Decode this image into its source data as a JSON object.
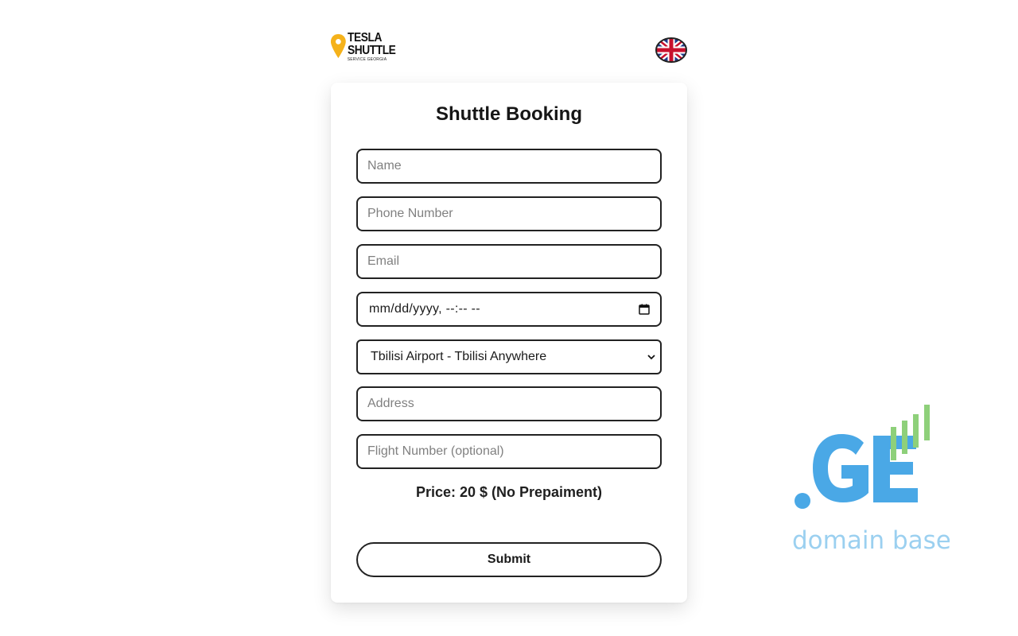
{
  "header": {
    "logo_line1": "TESLA",
    "logo_line2": "SHUTTLE",
    "logo_tagline": "SERVICE GEORGIA",
    "language_flag": "uk-flag-icon"
  },
  "form": {
    "title": "Shuttle Booking",
    "name_placeholder": "Name",
    "phone_placeholder": "Phone Number",
    "email_placeholder": "Email",
    "datetime_placeholder": "mm/dd/yyyy, --:-- --",
    "route_selected": "Tbilisi Airport - Tbilisi Anywhere",
    "address_placeholder": "Address",
    "flight_placeholder": "Flight Number (optional)",
    "price_text": "Price: 20 $ (No Prepaiment)",
    "submit_label": "Submit"
  },
  "watermark": {
    "main": ".GE",
    "subtitle": "domain base"
  },
  "colors": {
    "logo_pin": "#F5B21B",
    "ge_blue": "#4AA8E6",
    "ge_bars": "#8ED07A",
    "ge_subtitle": "#9BD0F0"
  }
}
